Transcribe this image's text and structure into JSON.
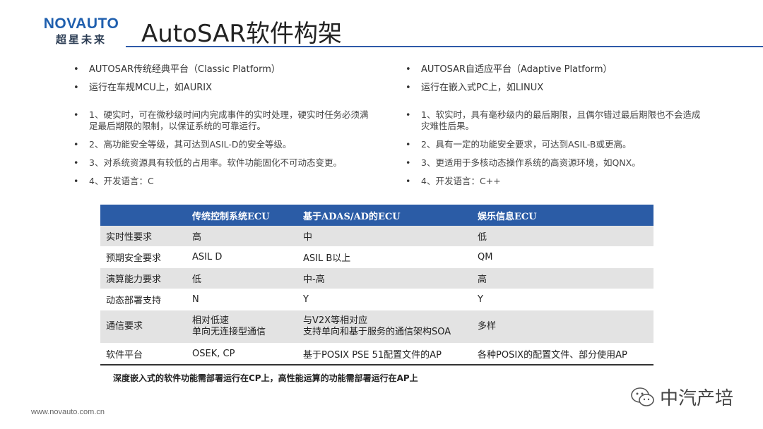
{
  "logo": {
    "en": "NOVAUTO",
    "cn": "超星未来"
  },
  "title": "AutoSAR软件构架",
  "left": {
    "items": [
      "AUTOSAR传统经典平台（Classic Platform）",
      "运行在车规MCU上，如AURIX"
    ],
    "details": [
      "1、硬实时，可在微秒级时间内完成事件的实时处理，硬实时任务必须满足最后期限的限制，以保证系统的可靠运行。",
      "2、高功能安全等级，其可达到ASIL-D的安全等级。",
      "3、对系统资源具有较低的占用率。软件功能固化不可动态变更。",
      "4、开发语言：C"
    ]
  },
  "right": {
    "items": [
      "AUTOSAR自适应平台（Adaptive Platform）",
      "运行在嵌入式PC上，如LINUX"
    ],
    "details": [
      "1、软实时，具有毫秒级内的最后期限，且偶尔错过最后期限也不会造成灾难性后果。",
      "2、具有一定的功能安全要求，可达到ASIL-B或更高。",
      "3、更适用于多核动态操作系统的高资源环境，如QNX。",
      "4、开发语言：C++"
    ]
  },
  "table": {
    "headers": [
      "",
      "传统控制系统ECU",
      "基于ADAS/AD的ECU",
      "娱乐信息ECU"
    ],
    "rows": [
      [
        "实时性要求",
        "高",
        "中",
        "低"
      ],
      [
        "预期安全要求",
        "ASIL D",
        "ASIL B以上",
        "QM"
      ],
      [
        "演算能力要求",
        "低",
        "中-高",
        "高"
      ],
      [
        "动态部署支持",
        "N",
        "Y",
        "Y"
      ],
      [
        "通信要求",
        "相对低速\n单向无连接型通信",
        "与V2X等相对应\n支持单向和基于服务的通信架构SOA",
        "多样"
      ],
      [
        "软件平台",
        "OSEK, CP",
        "基于POSIX PSE 51配置文件的AP",
        "各种POSIX的配置文件、部分使用AP"
      ]
    ]
  },
  "footnote": "深度嵌入式的软件功能需部署运行在CP上，高性能运算的功能需部署运行在AP上",
  "url": "www.novauto.com.cn",
  "watermark": {
    "text": "中汽产培",
    "icon": "wechat-icon"
  },
  "colors": {
    "accent": "#2b5ca6",
    "logo": "#1f5fae"
  }
}
